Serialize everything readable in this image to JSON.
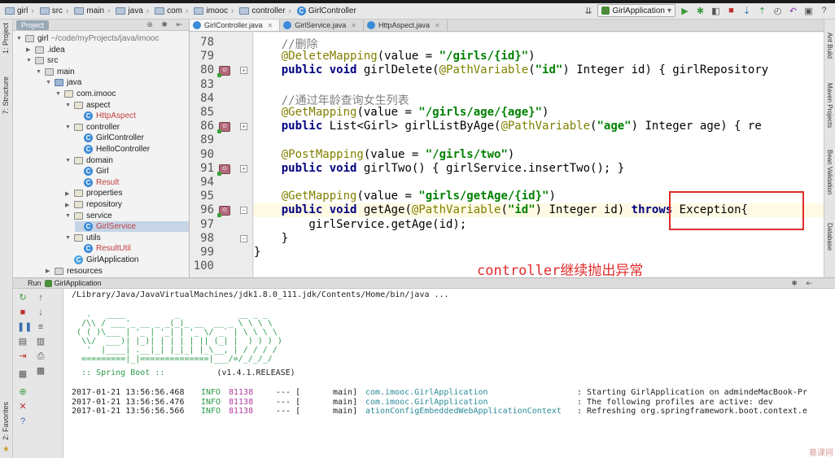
{
  "breadcrumb": [
    {
      "label": "girl",
      "kind": "folder"
    },
    {
      "label": "src",
      "kind": "folder"
    },
    {
      "label": "main",
      "kind": "folder"
    },
    {
      "label": "java",
      "kind": "folder"
    },
    {
      "label": "com",
      "kind": "folder"
    },
    {
      "label": "imooc",
      "kind": "folder"
    },
    {
      "label": "controller",
      "kind": "folder"
    },
    {
      "label": "GirlController",
      "kind": "class"
    }
  ],
  "toolbar": {
    "run_config": "GirlApplication"
  },
  "left_strip": {
    "project_label": "1: Project",
    "structure_label": "7: Structure",
    "favorites_label": "2: Favorites"
  },
  "right_strip": {
    "ant_label": "Ant Build",
    "maven_label": "Maven Projects",
    "bean_label": "Bean Validation",
    "database_label": "Database"
  },
  "project_panel": {
    "title": "Project",
    "tree": [
      {
        "label": "girl",
        "path": "~/code/myProjects/java/imooc",
        "kind": "folder",
        "arrow": "▼",
        "indent": 0
      },
      {
        "label": ".idea",
        "kind": "folder",
        "arrow": "▶",
        "indent": 1
      },
      {
        "label": "src",
        "kind": "folder",
        "arrow": "▼",
        "indent": 1
      },
      {
        "label": "main",
        "kind": "folder",
        "arrow": "▼",
        "indent": 2
      },
      {
        "label": "java",
        "kind": "src",
        "arrow": "▼",
        "indent": 3
      },
      {
        "label": "com.imooc",
        "kind": "pkg",
        "arrow": "▼",
        "indent": 4
      },
      {
        "label": "aspect",
        "kind": "pkg",
        "arrow": "▼",
        "indent": 5
      },
      {
        "label": "HttpAspect",
        "kind": "class",
        "arrow": "",
        "indent": 6
      },
      {
        "label": "controller",
        "kind": "pkg",
        "arrow": "▼",
        "indent": 5
      },
      {
        "label": "GirlController",
        "kind": "class",
        "arrow": "",
        "indent": 6
      },
      {
        "label": "HelloController",
        "kind": "class",
        "arrow": "",
        "indent": 6
      },
      {
        "label": "domain",
        "kind": "pkg",
        "arrow": "▼",
        "indent": 5
      },
      {
        "label": "Girl",
        "kind": "class",
        "arrow": "",
        "indent": 6
      },
      {
        "label": "Result",
        "kind": "class",
        "arrow": "",
        "indent": 6
      },
      {
        "label": "properties",
        "kind": "pkg",
        "arrow": "▶",
        "indent": 5
      },
      {
        "label": "repository",
        "kind": "pkg",
        "arrow": "▶",
        "indent": 5
      },
      {
        "label": "service",
        "kind": "pkg",
        "arrow": "▼",
        "indent": 5
      },
      {
        "label": "GirlService",
        "kind": "class",
        "arrow": "",
        "indent": 6,
        "selected": true
      },
      {
        "label": "utils",
        "kind": "pkg",
        "arrow": "▼",
        "indent": 5
      },
      {
        "label": "ResultUtil",
        "kind": "class",
        "arrow": "",
        "indent": 6
      },
      {
        "label": "GirlApplication",
        "kind": "app",
        "arrow": "",
        "indent": 5
      },
      {
        "label": "resources",
        "kind": "folder",
        "arrow": "▶",
        "indent": 3
      }
    ]
  },
  "editor_tabs": [
    {
      "label": "GirlController.java",
      "active": true
    },
    {
      "label": "GirlService.java",
      "active": false
    },
    {
      "label": "HttpAspect.java",
      "active": false
    }
  ],
  "editor": {
    "lines": [
      {
        "num": "78",
        "text": "    //删除"
      },
      {
        "num": "79",
        "text": "    @DeleteMapping(value = \"/girls/{id}\")"
      },
      {
        "num": "80",
        "text": "    public void girlDelete(@PathVariable(\"id\") Integer id) { girlRepository"
      },
      {
        "num": "83",
        "text": ""
      },
      {
        "num": "84",
        "text": "    //通过年龄查询女生列表"
      },
      {
        "num": "85",
        "text": "    @GetMapping(value = \"/girls/age/{age}\")"
      },
      {
        "num": "86",
        "text": "    public List<Girl> girlListByAge(@PathVariable(\"age\") Integer age) { re"
      },
      {
        "num": "89",
        "text": ""
      },
      {
        "num": "90",
        "text": "    @PostMapping(value = \"/girls/two\")"
      },
      {
        "num": "91",
        "text": "    public void girlTwo() { girlService.insertTwo(); }"
      },
      {
        "num": "94",
        "text": ""
      },
      {
        "num": "95",
        "text": "    @GetMapping(value = \"girls/getAge/{id}\")"
      },
      {
        "num": "96",
        "text": "    public void getAge(@PathVariable(\"id\") Integer id) throws Exception{"
      },
      {
        "num": "97",
        "text": "        girlService.getAge(id);"
      },
      {
        "num": "98",
        "text": "    }"
      },
      {
        "num": "99",
        "text": "}"
      },
      {
        "num": "100",
        "text": ""
      }
    ],
    "annotation_caption": "controller继续抛出异常"
  },
  "run_panel": {
    "label": "Run",
    "config": "GirlApplication",
    "java_cmd": "/Library/Java/JavaVirtualMachines/jdk1.8.0_111.jdk/Contents/Home/bin/java ...",
    "banner": "  .   ____          _            __ _ _\n /\\\\ / ___'_ __ _ _(_)_ __  __ _ \\ \\ \\ \\\n( ( )\\___ | '_ | '_| | '_ \\/ _` | \\ \\ \\ \\\n \\\\/  ___)| |_)| | | | | || (_| |  ) ) ) )\n  '  |____| .__|_| |_|_| |_\\__, | / / / /\n =========|_|==============|___/=/_/_/_/",
    "spring_boot": " :: Spring Boot ::",
    "spring_version": "(v1.4.1.RELEASE)",
    "logs": [
      {
        "time": "2017-01-21 13:56:56.468",
        "level": "INFO",
        "pid": "81138",
        "sep": "--- [",
        "thread": "main]",
        "logger": "com.imooc.GirlApplication",
        "msg": ": Starting GirlApplication on admindeMacBook-Pr"
      },
      {
        "time": "2017-01-21 13:56:56.476",
        "level": "INFO",
        "pid": "81138",
        "sep": "--- [",
        "thread": "main]",
        "logger": "com.imooc.GirlApplication",
        "msg": ": The following profiles are active: dev"
      },
      {
        "time": "2017-01-21 13:56:56.566",
        "level": "INFO",
        "pid": "81138",
        "sep": "--- [",
        "thread": "main]",
        "logger": "ationConfigEmbeddedWebApplicationContext",
        "msg": ": Refreshing org.springframework.boot.context.e"
      }
    ]
  },
  "watermark": "慕课网"
}
